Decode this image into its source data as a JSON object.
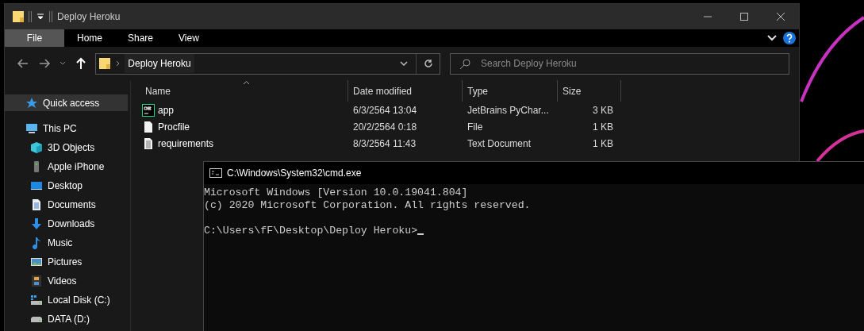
{
  "explorer": {
    "title": "Deploy Heroku",
    "ribbon_tabs": [
      {
        "label": "File",
        "selected": true
      },
      {
        "label": "Home",
        "selected": false
      },
      {
        "label": "Share",
        "selected": false
      },
      {
        "label": "View",
        "selected": false
      }
    ],
    "breadcrumb": "Deploy Heroku",
    "search": {
      "placeholder": "Search Deploy Heroku"
    },
    "nav": [
      {
        "label": "Quick access",
        "kind": "star",
        "selected": true
      },
      {
        "label": "This PC",
        "kind": "pc",
        "selected": false,
        "children": [
          {
            "label": "3D Objects",
            "kind": "cube",
            "selected": false
          },
          {
            "label": "Apple iPhone",
            "kind": "phone",
            "selected": false
          },
          {
            "label": "Desktop",
            "kind": "desktop",
            "selected": false
          },
          {
            "label": "Documents",
            "kind": "documents",
            "selected": false
          },
          {
            "label": "Downloads",
            "kind": "downloads",
            "selected": false
          },
          {
            "label": "Music",
            "kind": "music",
            "selected": false
          },
          {
            "label": "Pictures",
            "kind": "pictures",
            "selected": false
          },
          {
            "label": "Videos",
            "kind": "videos",
            "selected": false
          },
          {
            "label": "Local Disk (C:)",
            "kind": "system-disk",
            "selected": false
          },
          {
            "label": "DATA (D:)",
            "kind": "disk",
            "selected": false
          }
        ]
      }
    ],
    "columns": [
      "Name",
      "Date modified",
      "Type",
      "Size"
    ],
    "files": [
      {
        "name": "app",
        "kind": "pycharm",
        "date": "6/3/2564 13:04",
        "type": "JetBrains PyChar...",
        "size": "3 KB"
      },
      {
        "name": "Procfile",
        "kind": "blank",
        "date": "20/2/2564 0:18",
        "type": "File",
        "size": "1 KB"
      },
      {
        "name": "requirements",
        "kind": "text",
        "date": "8/3/2564 11:43",
        "type": "Text Document",
        "size": "1 KB"
      }
    ]
  },
  "terminal": {
    "title": "C:\\Windows\\System32\\cmd.exe",
    "output": [
      "Microsoft Windows [Version 10.0.19041.804]",
      "(c) 2020 Microsoft Corporation. All rights reserved."
    ],
    "prompt": "C:\\Users\\fF\\Desktop\\Deploy Heroku>"
  }
}
